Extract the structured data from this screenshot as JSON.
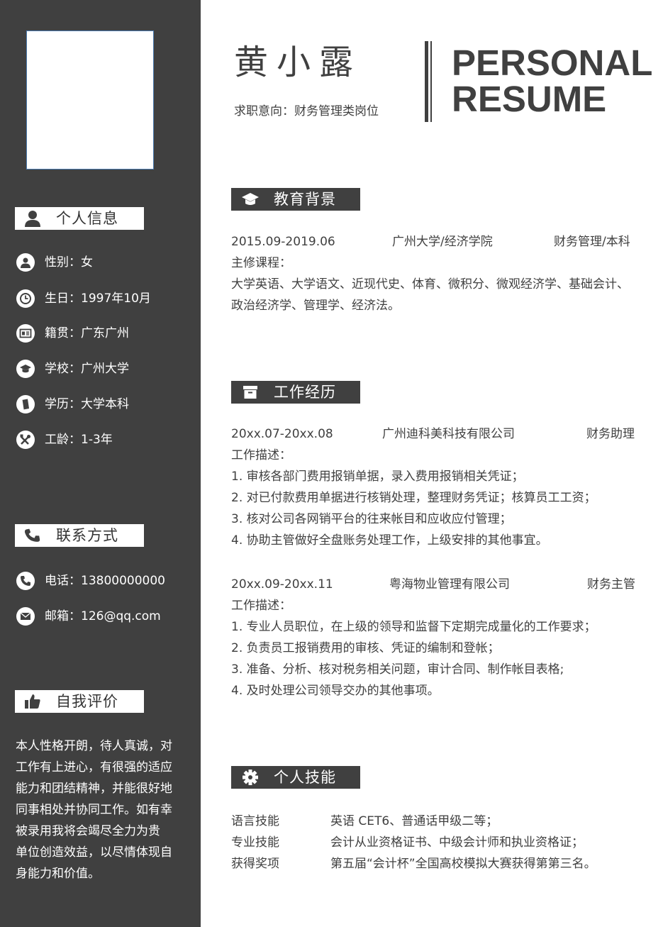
{
  "sidebar": {
    "personal_info": {
      "title": "个人信息",
      "items": [
        {
          "icon": "user-icon",
          "text": "性别：女"
        },
        {
          "icon": "clock-icon",
          "text": "生日：1997年10月"
        },
        {
          "icon": "id-card-icon",
          "text": "籍贯：广东广州"
        },
        {
          "icon": "graduation-cap-icon",
          "text": "学校：广州大学"
        },
        {
          "icon": "book-icon",
          "text": "学历：大学本科"
        },
        {
          "icon": "tools-icon",
          "text": "工龄：1-3年"
        }
      ]
    },
    "contact": {
      "title": "联系方式",
      "items": [
        {
          "icon": "phone-icon",
          "text": "电话：13800000000"
        },
        {
          "icon": "mail-icon",
          "text": "邮箱：126@qq.com"
        }
      ]
    },
    "self_eval": {
      "title": "自我评价",
      "lines": [
        "本人性格开朗，待人真诚，对",
        "工作有上进心，有很强的适应",
        "能力和团结精神，并能很好地",
        "同事相处并协同工作。如有幸",
        "被录用我将会竭尽全力为贵",
        "单位创造效益，以尽情体现自",
        "身能力和价值。"
      ]
    }
  },
  "header": {
    "name": "黄小露",
    "intent": "求职意向：财务管理类岗位",
    "title_line1": "PERSONAL",
    "title_line2": "RESUME"
  },
  "education": {
    "title": "教育背景",
    "period": "2015.09-2019.06",
    "school": "广州大学/经济学院",
    "major": "财务管理/本科",
    "courses_label": "主修课程：",
    "courses_line1": "大学英语、大学语文、近现代史、体育、微积分、微观经济学、基础会计、",
    "courses_line2": "政治经济学、管理学、经济法。"
  },
  "work": {
    "title": "工作经历",
    "jobs": [
      {
        "period": "20xx.07-20xx.08",
        "company": "广州迪科美科技有限公司",
        "position": "财务助理",
        "desc_label": "工作描述：",
        "duties": [
          "1. 审核各部门费用报销单据，录入费用报销相关凭证；",
          "2. 对已付款费用单据进行核销处理，整理财务凭证；核算员工工资；",
          "3. 核对公司各网销平台的往来帐目和应收应付管理；",
          "4. 协助主管做好全盘账务处理工作，上级安排的其他事宜。"
        ]
      },
      {
        "period": "20xx.09-20xx.11",
        "company": "粤海物业管理有限公司",
        "position": "财务主管",
        "desc_label": "工作描述：",
        "duties": [
          "1. 专业人员职位，在上级的领导和监督下定期完成量化的工作要求；",
          "2. 负责员工报销费用的审核、凭证的编制和登帐；",
          "3. 准备、分析、核对税务相关问题，审计合同、制作帐目表格;",
          "4. 及时处理公司领导交办的其他事项。"
        ]
      }
    ]
  },
  "skills": {
    "title": "个人技能",
    "items": [
      {
        "label": "语言技能",
        "value": "英语 CET6、普通话甲级二等；"
      },
      {
        "label": "专业技能",
        "value": "会计从业资格证书、中级会计师和执业资格证；"
      },
      {
        "label": "获得奖项",
        "value": "第五届“会计杯”全国高校模拟大赛获得第第三名。"
      }
    ]
  }
}
